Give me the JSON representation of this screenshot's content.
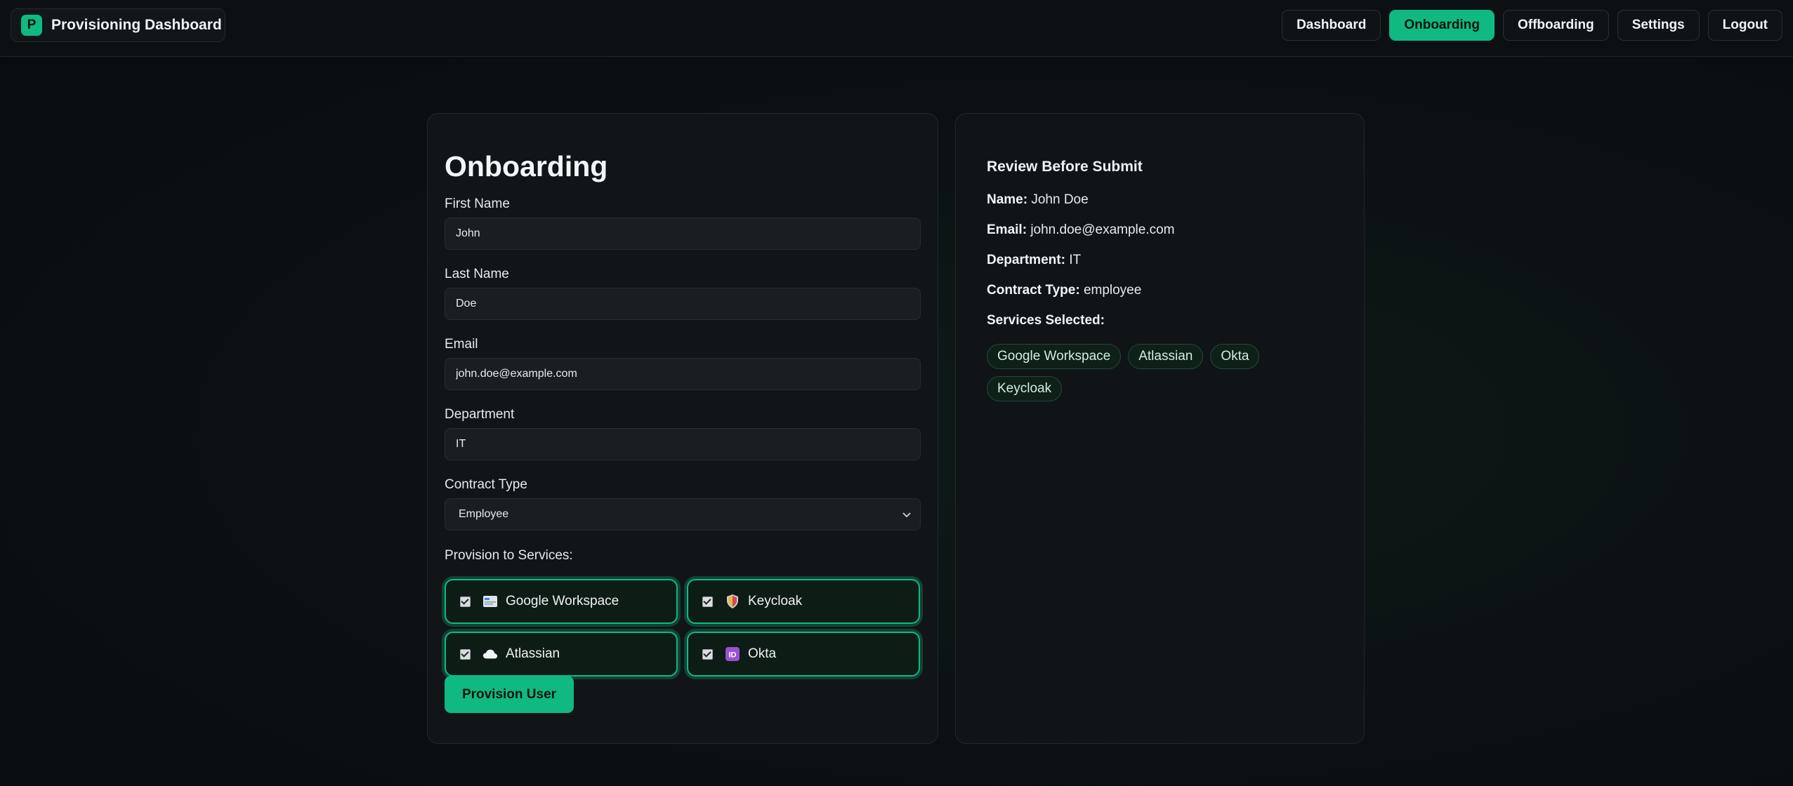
{
  "app": {
    "logo_letter": "P",
    "title": "Provisioning Dashboard"
  },
  "nav": {
    "items": [
      {
        "label": "Dashboard",
        "active": false
      },
      {
        "label": "Onboarding",
        "active": true
      },
      {
        "label": "Offboarding",
        "active": false
      },
      {
        "label": "Settings",
        "active": false
      },
      {
        "label": "Logout",
        "active": false
      }
    ]
  },
  "form": {
    "title": "Onboarding",
    "first_name": {
      "label": "First Name",
      "value": "John"
    },
    "last_name": {
      "label": "Last Name",
      "value": "Doe"
    },
    "email": {
      "label": "Email",
      "value": "john.doe@example.com"
    },
    "department": {
      "label": "Department",
      "value": "IT"
    },
    "contract_type": {
      "label": "Contract Type",
      "value": "Employee"
    },
    "services_label": "Provision to Services:",
    "services": [
      {
        "label": "Google Workspace",
        "checked": true,
        "icon": "workspace-icon"
      },
      {
        "label": "Keycloak",
        "checked": true,
        "icon": "shield-icon"
      },
      {
        "label": "Atlassian",
        "checked": true,
        "icon": "cloud-icon"
      },
      {
        "label": "Okta",
        "checked": true,
        "icon": "id-icon"
      }
    ],
    "submit_label": "Provision User"
  },
  "review": {
    "title": "Review Before Submit",
    "name_label": "Name:",
    "name_value": "John Doe",
    "email_label": "Email:",
    "email_value": "john.doe@example.com",
    "department_label": "Department:",
    "department_value": "IT",
    "contract_label": "Contract Type:",
    "contract_value": "employee",
    "services_label": "Services Selected:",
    "services": [
      "Google Workspace",
      "Atlassian",
      "Okta",
      "Keycloak"
    ]
  },
  "colors": {
    "accent": "#10b981",
    "background": "#0b0f12",
    "card": "#111518"
  }
}
